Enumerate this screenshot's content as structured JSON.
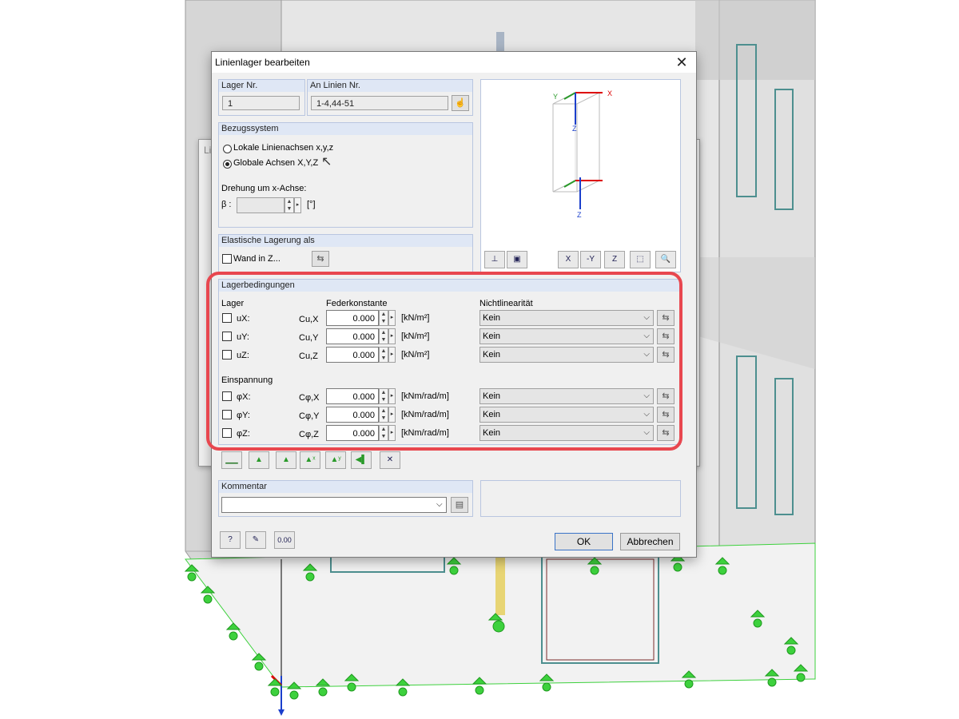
{
  "dialog": {
    "title": "Linienlager bearbeiten",
    "close_glyph": "✕"
  },
  "lager_nr": {
    "header": "Lager Nr.",
    "value": "1"
  },
  "an_linien": {
    "header": "An Linien Nr.",
    "value": "1-4,44-51"
  },
  "bezugssystem": {
    "header": "Bezugssystem",
    "option_local": "Lokale Linienachsen x,y,z",
    "option_global": "Globale Achsen X,Y,Z",
    "selected": "global",
    "rotation_label": "Drehung um x-Achse:",
    "beta_label": "β :",
    "beta_unit": "[°]"
  },
  "elastische": {
    "header": "Elastische Lagerung als",
    "wand_label": "Wand in Z..."
  },
  "preview": {
    "axis_x": "X",
    "axis_y": "Y",
    "axis_z": "Z",
    "axis_z2": "Z",
    "toolbar_x": "X",
    "toolbar_y": "-Y",
    "toolbar_z": "Z"
  },
  "lagerbedingungen": {
    "header": "Lagerbedingungen",
    "col_lager": "Lager",
    "col_feder": "Federkonstante",
    "col_nonlin": "Nichtlinearität",
    "translations": [
      {
        "label": "uX:",
        "const": "Cu,X",
        "value": "0.000",
        "unit": "[kN/m²]",
        "nonlin": "Kein"
      },
      {
        "label": "uY:",
        "const": "Cu,Y",
        "value": "0.000",
        "unit": "[kN/m²]",
        "nonlin": "Kein"
      },
      {
        "label": "uZ:",
        "const": "Cu,Z",
        "value": "0.000",
        "unit": "[kN/m²]",
        "nonlin": "Kein"
      }
    ],
    "einspannung_label": "Einspannung",
    "rotations": [
      {
        "label": "φX:",
        "const": "Cφ,X",
        "value": "0.000",
        "unit": "[kNm/rad/m]",
        "nonlin": "Kein"
      },
      {
        "label": "φY:",
        "const": "Cφ,Y",
        "value": "0.000",
        "unit": "[kNm/rad/m]",
        "nonlin": "Kein"
      },
      {
        "label": "φZ:",
        "const": "Cφ,Z",
        "value": "0.000",
        "unit": "[kNm/rad/m]",
        "nonlin": "Kein"
      }
    ]
  },
  "kommentar": {
    "header": "Kommentar",
    "value": ""
  },
  "footer": {
    "ok": "OK",
    "cancel": "Abbrechen",
    "values_icon": "0.00"
  },
  "background": {
    "dialog_title_fragment": "Lin",
    "close_glyph": "✕"
  },
  "colors": {
    "highlight": "#e8474f",
    "support_green": "#3dd13d",
    "wall_gray": "#d9d9d9",
    "header_blue": "#dfe7f5"
  }
}
